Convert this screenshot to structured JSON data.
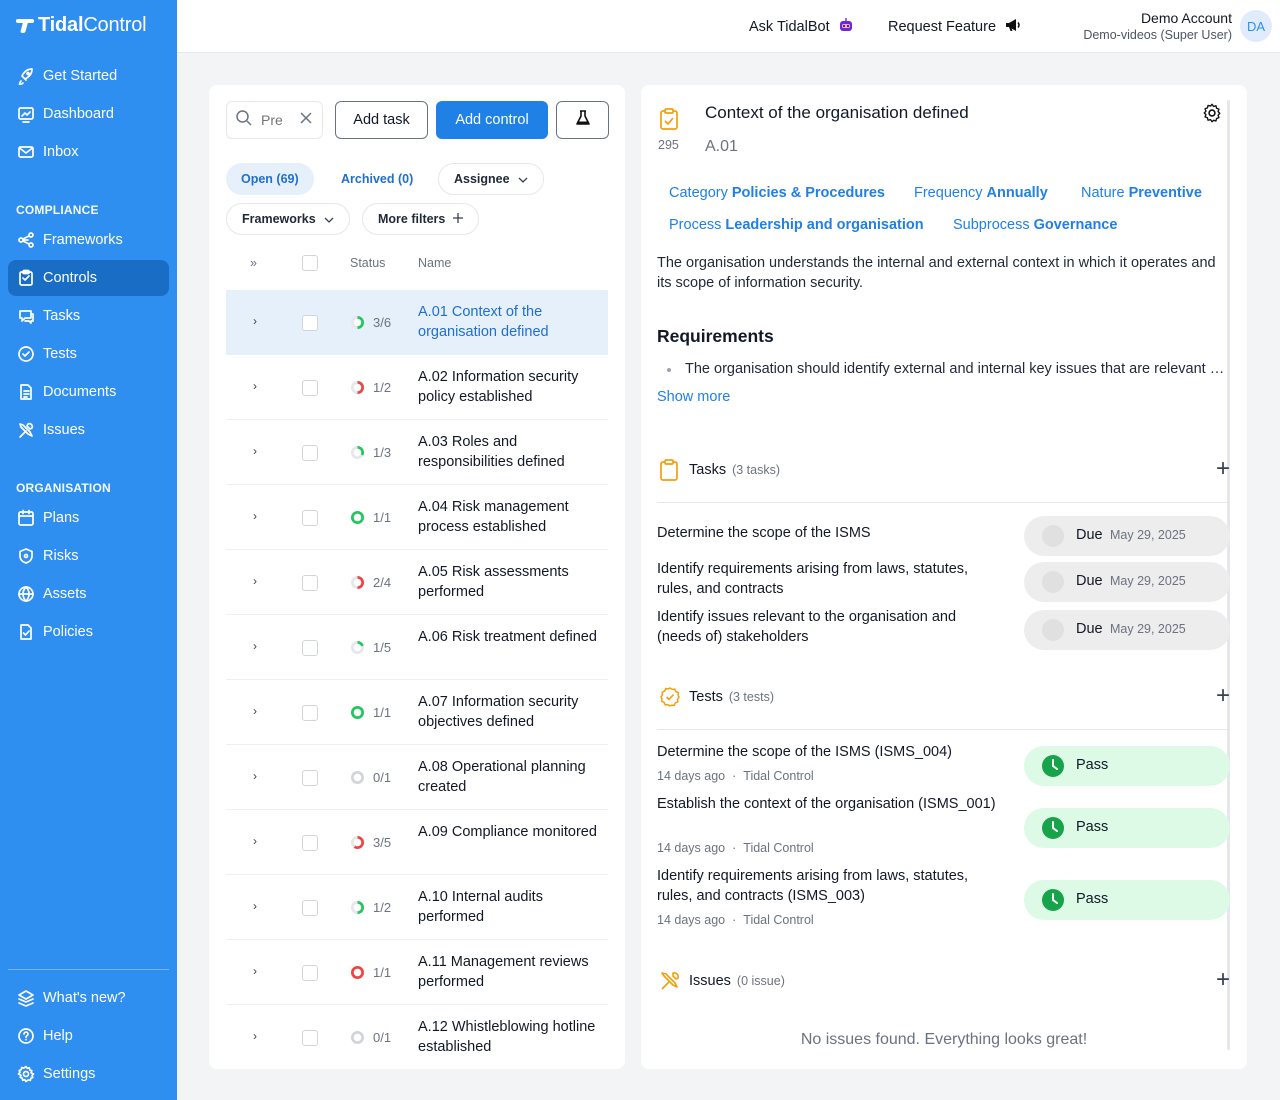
{
  "brand": {
    "tidal": "Tidal",
    "control": "Control"
  },
  "nav": {
    "main": [
      {
        "key": "get-started",
        "label": "Get Started",
        "icon": "rocket-icon"
      },
      {
        "key": "dashboard",
        "label": "Dashboard",
        "icon": "chart-icon"
      },
      {
        "key": "inbox",
        "label": "Inbox",
        "icon": "mail-icon"
      }
    ],
    "compliance_label": "COMPLIANCE",
    "compliance": [
      {
        "key": "frameworks",
        "label": "Frameworks",
        "icon": "frameworks-icon"
      },
      {
        "key": "controls",
        "label": "Controls",
        "icon": "controls-icon",
        "active": true
      },
      {
        "key": "tasks",
        "label": "Tasks",
        "icon": "chat-icon"
      },
      {
        "key": "tests",
        "label": "Tests",
        "icon": "check-circle-icon"
      },
      {
        "key": "documents",
        "label": "Documents",
        "icon": "document-icon"
      },
      {
        "key": "issues",
        "label": "Issues",
        "icon": "tools-icon"
      }
    ],
    "organisation_label": "ORGANISATION",
    "organisation": [
      {
        "key": "plans",
        "label": "Plans",
        "icon": "calendar-icon"
      },
      {
        "key": "risks",
        "label": "Risks",
        "icon": "shield-icon"
      },
      {
        "key": "assets",
        "label": "Assets",
        "icon": "globe-icon"
      },
      {
        "key": "policies",
        "label": "Policies",
        "icon": "policy-icon"
      }
    ],
    "bottom": [
      {
        "key": "whats-new",
        "label": "What's new?",
        "icon": "bell-icon"
      },
      {
        "key": "help",
        "label": "Help",
        "icon": "help-icon"
      },
      {
        "key": "settings",
        "label": "Settings",
        "icon": "gear-icon"
      }
    ]
  },
  "topbar": {
    "ask": "Ask TidalBot",
    "request": "Request Feature",
    "account_name": "Demo Account",
    "account_sub": "Demo-videos (Super User)",
    "avatar": "DA"
  },
  "toolbar": {
    "search_placeholder": "Pre",
    "add_task": "Add task",
    "add_control": "Add control"
  },
  "filters": {
    "open": "Open (69)",
    "archived": "Archived (0)",
    "assignee": "Assignee",
    "frameworks": "Frameworks",
    "more": "More filters"
  },
  "table": {
    "expand": "»",
    "status": "Status",
    "name": "Name",
    "rows": [
      {
        "count": "3/6",
        "name": "A.01 Context of the organisation defined",
        "color": "#22c55e",
        "frac": 0.5,
        "selected": true
      },
      {
        "count": "1/2",
        "name": "A.02 Information security policy established",
        "color": "#ef4444",
        "frac": 0.5
      },
      {
        "count": "1/3",
        "name": "A.03 Roles and responsibilities defined",
        "color": "#22c55e",
        "frac": 0.33
      },
      {
        "count": "1/1",
        "name": "A.04 Risk management process established",
        "color": "#22c55e",
        "frac": 1
      },
      {
        "count": "2/4",
        "name": "A.05 Risk assessments performed",
        "color": "#ef4444",
        "frac": 0.5
      },
      {
        "count": "1/5",
        "name": "A.06 Risk treatment defined",
        "color": "#22c55e",
        "frac": 0.2
      },
      {
        "count": "1/1",
        "name": "A.07 Information security objectives defined",
        "color": "#22c55e",
        "frac": 1
      },
      {
        "count": "0/1",
        "name": "A.08 Operational planning created",
        "color": "#d1d5db",
        "frac": 0
      },
      {
        "count": "3/5",
        "name": "A.09 Compliance monitored",
        "color": "#ef4444",
        "frac": 0.6
      },
      {
        "count": "1/2",
        "name": "A.10 Internal audits performed",
        "color": "#22c55e",
        "frac": 0.5
      },
      {
        "count": "1/1",
        "name": "A.11 Management reviews performed",
        "color": "#ef4444",
        "frac": 1
      },
      {
        "count": "0/1",
        "name": "A.12 Whistleblowing hotline established",
        "color": "#d1d5db",
        "frac": 0
      }
    ]
  },
  "detail": {
    "title": "Context of the organisation defined",
    "number": "295",
    "code": "A.01",
    "props": {
      "category_label": "Category",
      "category": "Policies & Procedures",
      "frequency_label": "Frequency",
      "frequency": "Annually",
      "nature_label": "Nature",
      "nature": "Preventive",
      "process_label": "Process",
      "process": "Leadership and organisation",
      "subprocess_label": "Subprocess",
      "subprocess": "Governance"
    },
    "description": "The organisation understands the internal and external context in which it operates and its scope of information security.",
    "requirements_title": "Requirements",
    "requirement": "The organisation should identify external and internal key issues that are relevant to its purpose and that affect its ability to achieve the intended outcomes.",
    "show_more": "Show more",
    "tasks_title": "Tasks",
    "tasks_count": "(3 tasks)",
    "tasks": [
      {
        "name": "Determine the scope of the ISMS",
        "status": "Due",
        "date": "May 29, 2025"
      },
      {
        "name": "Identify requirements arising from laws, statutes, rules, and contracts",
        "status": "Due",
        "date": "May 29, 2025"
      },
      {
        "name": "Identify issues relevant to the organisation and (needs of) stakeholders",
        "status": "Due",
        "date": "May 29, 2025"
      }
    ],
    "tests_title": "Tests",
    "tests_count": "(3 tests)",
    "tests": [
      {
        "name": "Determine the scope of the ISMS (ISMS_004)",
        "age": "14 days ago",
        "source": "Tidal Control",
        "status": "Pass"
      },
      {
        "name": "Establish the context of the organisation (ISMS_001)",
        "age": "14 days ago",
        "source": "Tidal Control",
        "status": "Pass"
      },
      {
        "name": "Identify requirements arising from laws, statutes, rules, and contracts (ISMS_003)",
        "age": "14 days ago",
        "source": "Tidal Control",
        "status": "Pass"
      }
    ],
    "issues_title": "Issues",
    "issues_count": "(0 issue)",
    "issues_empty": "No issues found. Everything looks great!"
  },
  "colors": {
    "sidebar": "#2f8ff0",
    "sidebar_active": "#1a6dc4",
    "primary": "#1f80e6",
    "pass": "#16a34a",
    "task_orange": "#f59e0b"
  }
}
